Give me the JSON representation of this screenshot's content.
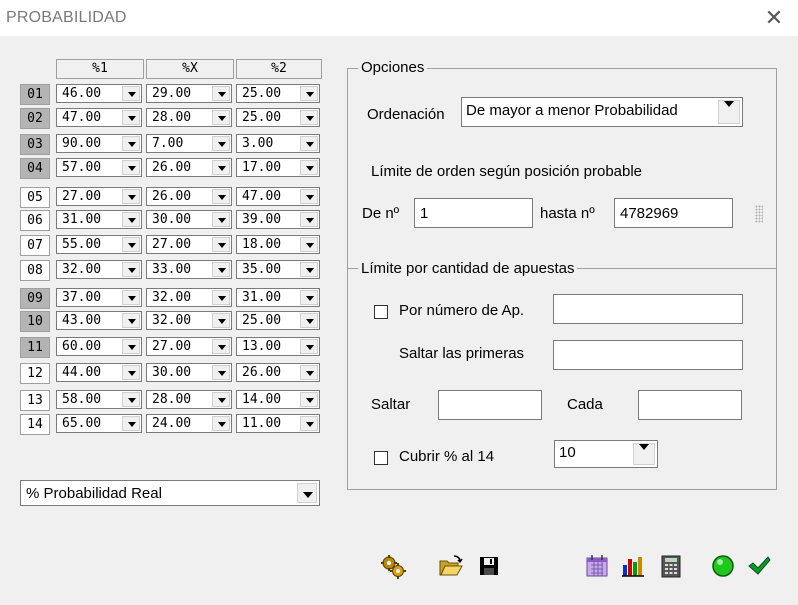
{
  "window": {
    "title": "PROBABILIDAD",
    "close_glyph": "✕"
  },
  "grid": {
    "headers": [
      "%1",
      "%X",
      "%2"
    ],
    "rows": [
      {
        "label": "01",
        "shaded": true,
        "values": [
          "46.00",
          "29.00",
          "25.00"
        ]
      },
      {
        "label": "02",
        "shaded": true,
        "values": [
          "47.00",
          "28.00",
          "25.00"
        ]
      },
      {
        "label": "03",
        "shaded": true,
        "values": [
          "90.00",
          "7.00",
          "3.00"
        ]
      },
      {
        "label": "04",
        "shaded": true,
        "values": [
          "57.00",
          "26.00",
          "17.00"
        ]
      },
      {
        "label": "05",
        "shaded": false,
        "values": [
          "27.00",
          "26.00",
          "47.00"
        ]
      },
      {
        "label": "06",
        "shaded": false,
        "values": [
          "31.00",
          "30.00",
          "39.00"
        ]
      },
      {
        "label": "07",
        "shaded": false,
        "values": [
          "55.00",
          "27.00",
          "18.00"
        ]
      },
      {
        "label": "08",
        "shaded": false,
        "values": [
          "32.00",
          "33.00",
          "35.00"
        ]
      },
      {
        "label": "09",
        "shaded": true,
        "values": [
          "37.00",
          "32.00",
          "31.00"
        ]
      },
      {
        "label": "10",
        "shaded": true,
        "values": [
          "43.00",
          "32.00",
          "25.00"
        ]
      },
      {
        "label": "11",
        "shaded": true,
        "values": [
          "60.00",
          "27.00",
          "13.00"
        ]
      },
      {
        "label": "12",
        "shaded": false,
        "values": [
          "44.00",
          "30.00",
          "26.00"
        ]
      },
      {
        "label": "13",
        "shaded": false,
        "values": [
          "58.00",
          "28.00",
          "14.00"
        ]
      },
      {
        "label": "14",
        "shaded": false,
        "values": [
          "65.00",
          "24.00",
          "11.00"
        ]
      }
    ]
  },
  "probability_type": {
    "value": "% Probabilidad Real"
  },
  "options": {
    "legend": "Opciones",
    "ordering_label": "Ordenación",
    "ordering_value": "De mayor a menor Probabilidad",
    "limit_position_label": "Límite de orden según posición probable",
    "from_label": "De nº",
    "from_value": "1",
    "to_label": "hasta nº",
    "to_value": "4782969"
  },
  "bet_limit": {
    "legend": "Límite por cantidad de apuestas",
    "by_number_label": "Por número de Ap.",
    "by_number_value": "",
    "skip_first_label": "Saltar las primeras",
    "skip_first_value": "",
    "skip_label": "Saltar",
    "skip_value": "",
    "every_label": "Cada",
    "every_value": "",
    "cover_label": "Cubrir % al 14",
    "cover_value": "10"
  },
  "toolbar": {
    "icons": [
      "gears-icon",
      "open-folder-icon",
      "save-disk-icon",
      "calendar-icon",
      "bar-chart-icon",
      "calculator-icon",
      "green-circle-icon",
      "checkmark-icon"
    ]
  }
}
